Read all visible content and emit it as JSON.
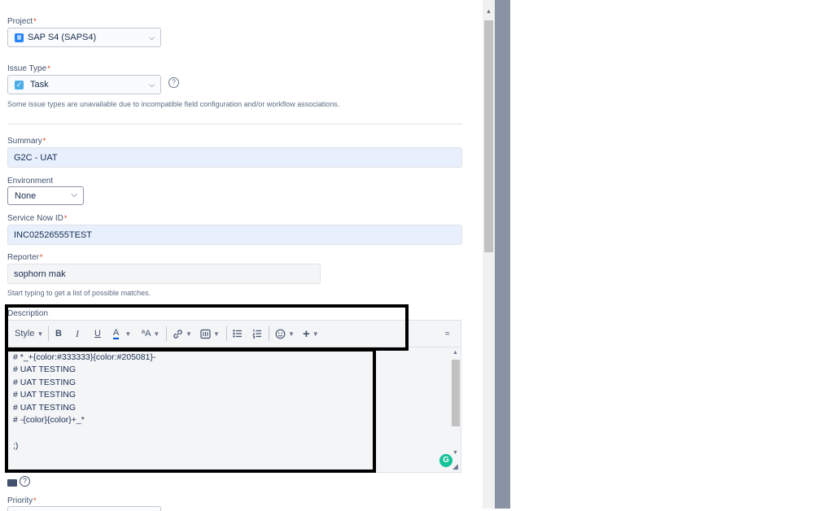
{
  "project": {
    "label": "Project",
    "required": "*",
    "value": "SAP S4 (SAPS4)"
  },
  "issue_type": {
    "label": "Issue Type",
    "required": "*",
    "value": "Task",
    "note": "Some issue types are unavailable due to incompatible field configuration and/or workflow associations."
  },
  "summary": {
    "label": "Summary",
    "required": "*",
    "value": "G2C - UAT"
  },
  "environment": {
    "label": "Environment",
    "value": "None"
  },
  "service_now_id": {
    "label": "Service Now ID",
    "required": "*",
    "value": "INC02526555TEST"
  },
  "reporter": {
    "label": "Reporter",
    "required": "*",
    "value": "sophorn mak",
    "help": "Start typing to get a list of possible matches."
  },
  "description": {
    "label": "Description",
    "toolbar": {
      "style": "Style",
      "bold": "B",
      "italic": "I",
      "underline": "U",
      "text_color": "A",
      "text_size": "ªA"
    },
    "lines": [
      "# *_+{color:#333333}{color:#205081}-",
      "# UAT TESTING",
      "# UAT TESTING",
      "# UAT TESTING",
      "# UAT TESTING",
      "# -{color}{color}+_*",
      "",
      ";)"
    ]
  },
  "priority": {
    "label": "Priority",
    "required": "*"
  },
  "colors": {
    "accent": "#0052cc",
    "required": "#de350b",
    "grammarly": "#15c39a",
    "sidebar": "#8993a4"
  }
}
